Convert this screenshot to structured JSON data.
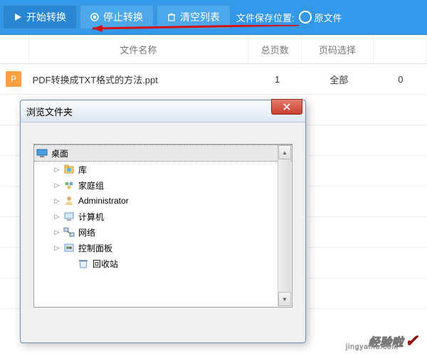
{
  "toolbar": {
    "start": "开始转换",
    "stop": "停止转换",
    "clear": "清空列表",
    "save_loc": "文件保存位置:",
    "radio_orig": "原文件"
  },
  "headers": {
    "name": "文件名称",
    "pages": "总页数",
    "select": "页码选择"
  },
  "rows": [
    {
      "icon": "P",
      "name": "PDF转换成TXT格式的方法.ppt",
      "pages": "1",
      "select": "全部",
      "last": "0"
    }
  ],
  "dialog": {
    "title": "浏览文件夹",
    "tree": [
      {
        "label": "桌面",
        "icon": "desktop",
        "root": true
      },
      {
        "label": "库",
        "icon": "library",
        "expand": true,
        "indent": 1
      },
      {
        "label": "家庭组",
        "icon": "homegroup",
        "expand": true,
        "indent": 1
      },
      {
        "label": "Administrator",
        "icon": "user",
        "expand": true,
        "indent": 1
      },
      {
        "label": "计算机",
        "icon": "computer",
        "expand": true,
        "indent": 1
      },
      {
        "label": "网络",
        "icon": "network",
        "expand": true,
        "indent": 1
      },
      {
        "label": "控制面板",
        "icon": "control",
        "expand": true,
        "indent": 1
      },
      {
        "label": "回收站",
        "icon": "recycle",
        "expand": false,
        "indent": 2
      }
    ]
  },
  "watermark": {
    "text": "经验啦",
    "url": "jingyanla.com"
  }
}
